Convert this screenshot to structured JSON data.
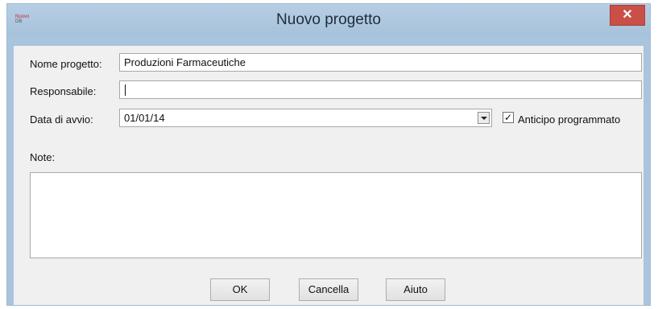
{
  "window": {
    "title": "Nuovo progetto",
    "close_label": "✕",
    "icon_text_1": "Nuovo",
    "icon_text_2": "DB"
  },
  "form": {
    "name_label": "Nome progetto:",
    "name_value": "Produzioni Farmaceutiche",
    "manager_label": "Responsabile:",
    "manager_value": "",
    "start_label": "Data di avvio:",
    "start_value": "01/01/14",
    "advance_label": "Anticipo programmato",
    "advance_checked": true,
    "notes_label": "Note:",
    "notes_value": ""
  },
  "buttons": {
    "ok": "OK",
    "cancel": "Cancella",
    "help": "Aiuto"
  }
}
